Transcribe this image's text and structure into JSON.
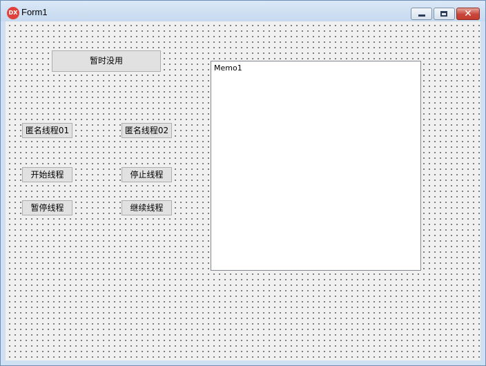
{
  "window": {
    "title": "Form1",
    "app_icon_text": "DX",
    "controls": {
      "minimize": "minimize",
      "maximize": "maximize",
      "close": "close"
    }
  },
  "buttons": {
    "disabled_label": "暂时没用",
    "anon_thread_1": "匿名线程01",
    "anon_thread_2": "匿名线程02",
    "start_thread": "开始线程",
    "stop_thread": "停止线程",
    "pause_thread": "暂停线程",
    "resume_thread": "继续线程"
  },
  "memo": {
    "text": "Memo1"
  },
  "colors": {
    "titlebar": "#cfe0f3",
    "client_background": "#f0f0f0",
    "close_button": "#c7453a",
    "button_face": "#e1e1e1"
  }
}
